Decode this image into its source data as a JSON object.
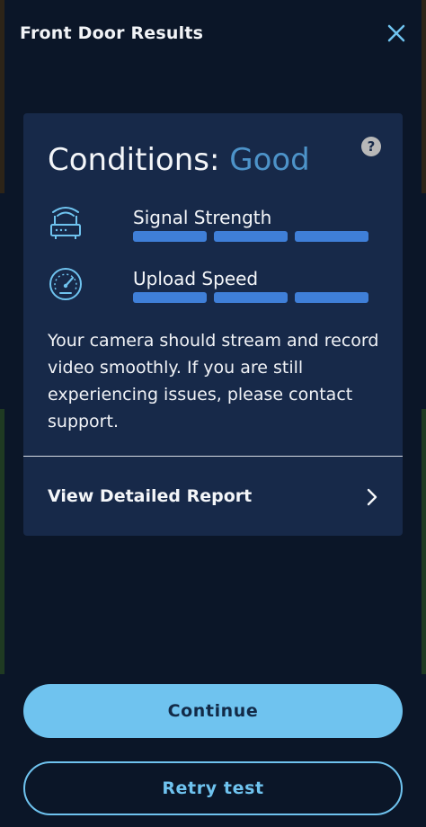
{
  "header": {
    "title": "Front Door Results",
    "close_icon": "close-icon"
  },
  "card": {
    "help_glyph": "?",
    "conditions_prefix": "Conditions:",
    "conditions_value": "Good",
    "conditions_color": "#4d93c9",
    "metrics": [
      {
        "label": "Signal Strength",
        "icon": "router-icon",
        "bars_filled": 3,
        "bars_total": 3
      },
      {
        "label": "Upload Speed",
        "icon": "speedometer-icon",
        "bars_filled": 3,
        "bars_total": 3
      }
    ],
    "description": "Your camera should stream and record video smoothly. If you are still experiencing issues, please contact support.",
    "report_label": "View Detailed Report"
  },
  "buttons": {
    "continue_label": "Continue",
    "retry_label": "Retry test"
  },
  "colors": {
    "background": "#0b1628",
    "card": "#172949",
    "accent": "#6fc3ef",
    "bar": "#3f7fd8"
  }
}
